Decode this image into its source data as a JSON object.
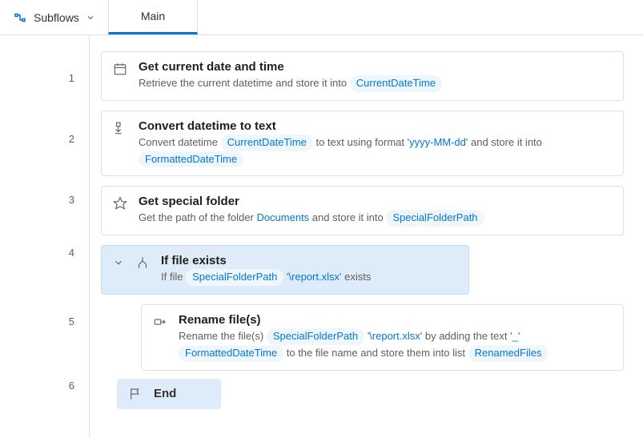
{
  "header": {
    "subflows_label": "Subflows",
    "tab_main": "Main"
  },
  "lines": {
    "l1": "1",
    "l2": "2",
    "l3": "3",
    "l4": "4",
    "l5": "5",
    "l6": "6"
  },
  "actions": {
    "a1": {
      "title": "Get current date and time",
      "desc_prefix": "Retrieve the current datetime and store it into ",
      "var": "CurrentDateTime"
    },
    "a2": {
      "title": "Convert datetime to text",
      "p1": "Convert datetime ",
      "var1": "CurrentDateTime",
      "p2": " to text using format ",
      "fmt": "yyyy-MM-dd",
      "p3": " and store it into ",
      "var2": "FormattedDateTime"
    },
    "a3": {
      "title": "Get special folder",
      "p1": "Get the path of the folder ",
      "folder": "Documents",
      "p2": " and store it into ",
      "var": "SpecialFolderPath"
    },
    "a4": {
      "title": "If file exists",
      "p1": "If file ",
      "var": "SpecialFolderPath",
      "path": "\\report.xlsx",
      "p2": " exists"
    },
    "a5": {
      "title": "Rename file(s)",
      "p1": "Rename the file(s) ",
      "var1": "SpecialFolderPath",
      "path": "\\report.xlsx",
      "p2": " by adding the text ",
      "txt": "_",
      "var2": "FormattedDateTime",
      "p3": " to the file name and store them into list ",
      "var3": "RenamedFiles"
    },
    "a6": {
      "title": "End"
    }
  }
}
